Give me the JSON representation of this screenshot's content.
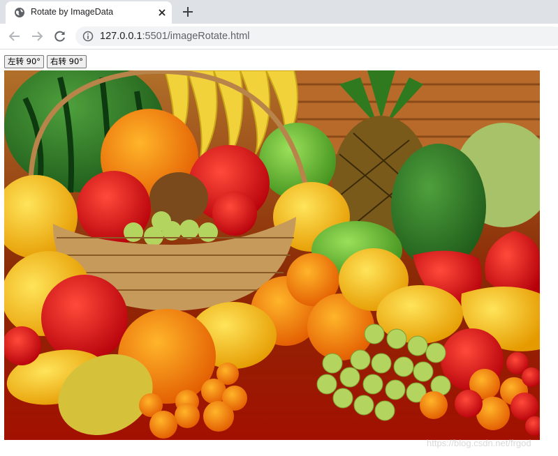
{
  "browser": {
    "tab": {
      "title": "Rotate by ImageData",
      "favicon": "globe-icon",
      "close_icon": "close-icon"
    },
    "new_tab_icon": "plus-icon",
    "nav": {
      "back_icon": "back-arrow-icon",
      "forward_icon": "forward-arrow-icon",
      "reload_icon": "reload-icon"
    },
    "address": {
      "info_icon": "info-icon",
      "host": "127.0.0.1",
      "rest": ":5501/imageRotate.html"
    }
  },
  "page": {
    "rotate_left_label": "左转 90°",
    "rotate_right_label": "右转 90°",
    "image_subject": "fruit still life",
    "watermark": "https://blog.csdn.net/frgod"
  },
  "colors": {
    "tabstrip": "#dee1e6",
    "omnibox": "#f1f3f4",
    "background_red": "#a31000"
  }
}
